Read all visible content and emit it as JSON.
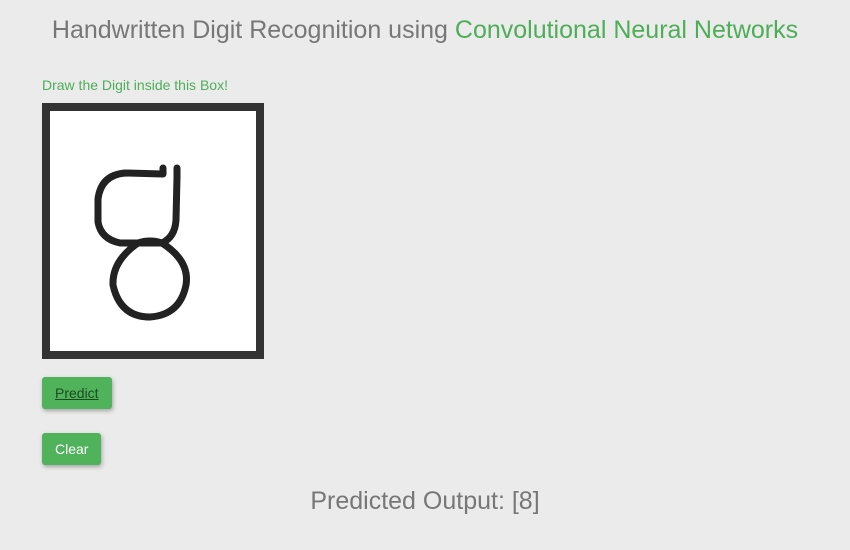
{
  "header": {
    "title_prefix": "Handwritten Digit Recognition using ",
    "title_highlight": "Convolutional Neural Networks"
  },
  "instruction": "Draw the Digit inside this Box!",
  "buttons": {
    "predict": "Predict",
    "clear": "Clear"
  },
  "output": {
    "label": "Predicted Output: ",
    "value": "[8]"
  }
}
